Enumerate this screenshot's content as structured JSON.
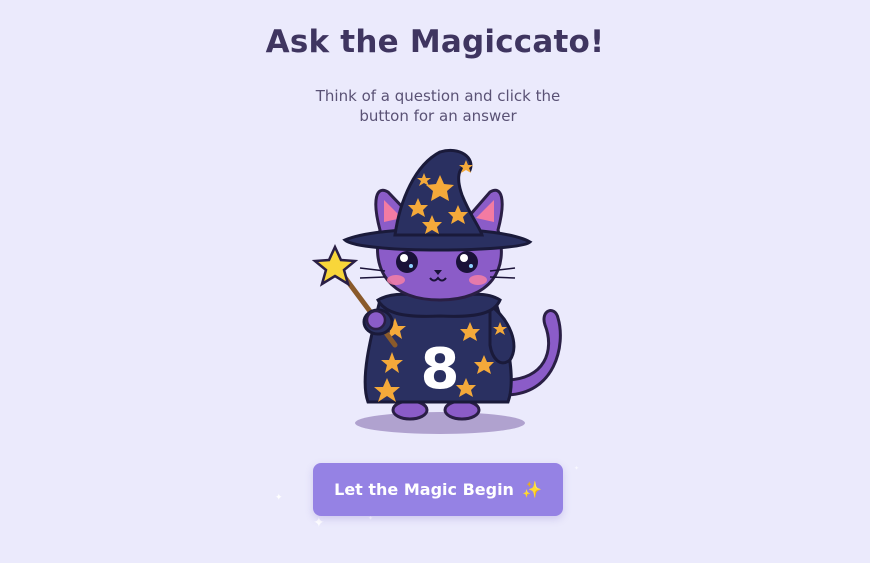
{
  "header": {
    "title": "Ask the Magiccato!",
    "subtitle": "Think of a question and click the button for an answer"
  },
  "mascot": {
    "description_icon": "wizard-cat-icon",
    "number": "8"
  },
  "action": {
    "button_label": "Let the Magic Begin",
    "button_emoji": "✨"
  },
  "colors": {
    "background": "#ebeafc",
    "title": "#3f3560",
    "button": "#9582e4",
    "cat_body": "#8b5cc8",
    "robe": "#2a3061",
    "stars": "#f4a93a"
  }
}
